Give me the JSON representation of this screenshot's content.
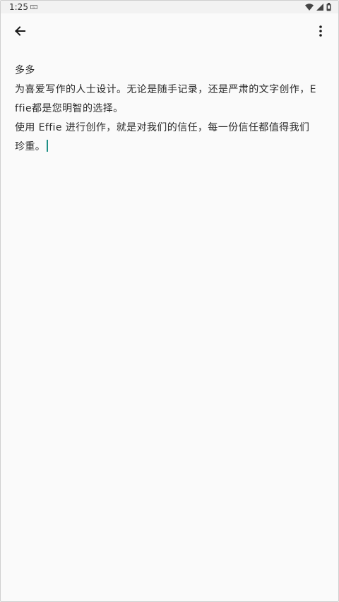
{
  "status_bar": {
    "time": "1:25",
    "icons": [
      "notification-keyboard-icon",
      "wifi-icon",
      "signal-icon",
      "battery-icon"
    ]
  },
  "app_bar": {
    "back_icon": "arrow-left-icon",
    "more_icon": "more-vertical-icon"
  },
  "note": {
    "title": "多多",
    "paragraphs": [
      "为喜爱写作的人士设计。无论是随手记录，还是严肃的文字创作，Effie都是您明智的选择。",
      "使用 Effie 进行创作，就是对我们的信任，每一份信任都值得我们珍重。"
    ]
  },
  "colors": {
    "caret": "#1e8f86",
    "background": "#fafafa",
    "status_bar": "#f2f2f2"
  }
}
